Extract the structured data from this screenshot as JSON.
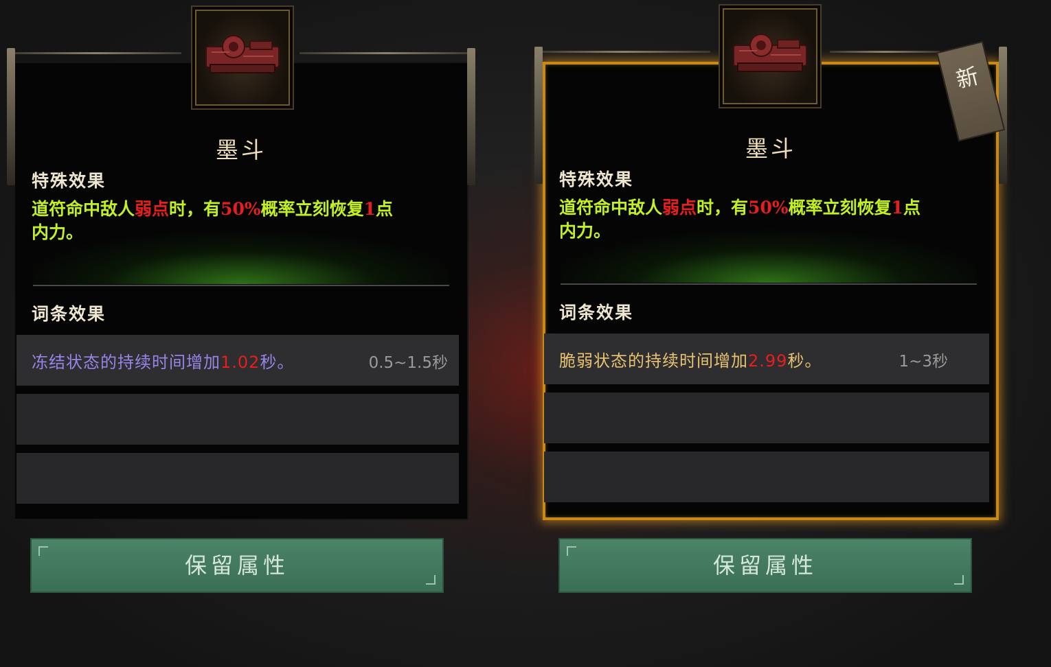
{
  "cards": [
    {
      "item_name": "墨斗",
      "special_title": "特殊效果",
      "special_parts": [
        "道符命中敌人",
        "弱点",
        "时，有",
        "50%",
        "概率立刻恢复",
        "1",
        "点",
        "内力。"
      ],
      "affix_title": "词条效果",
      "affix": {
        "prefix": "冻结状态的持续时间增加",
        "value": "1.02",
        "suffix": "秒。",
        "range": "0.5~1.5秒",
        "color": "#9b84e8"
      },
      "empty_affix_rows": 2,
      "selected": false,
      "button_label": "保留属性"
    },
    {
      "item_name": "墨斗",
      "special_title": "特殊效果",
      "special_parts": [
        "道符命中敌人",
        "弱点",
        "时，有",
        "50%",
        "概率立刻恢复",
        "1",
        "点",
        "内力。"
      ],
      "affix_title": "词条效果",
      "affix": {
        "prefix": "脆弱状态的持续时间增加",
        "value": "2.99",
        "suffix": "秒。",
        "range": "1~3秒",
        "color": "#e8c270"
      },
      "empty_affix_rows": 2,
      "selected": true,
      "new_tag": "新",
      "button_label": "保留属性"
    }
  ],
  "colors": {
    "special_text": "#c3f022",
    "highlight": "#e51f1f",
    "selected_border": "#c98a14",
    "button": "#437a5e"
  }
}
